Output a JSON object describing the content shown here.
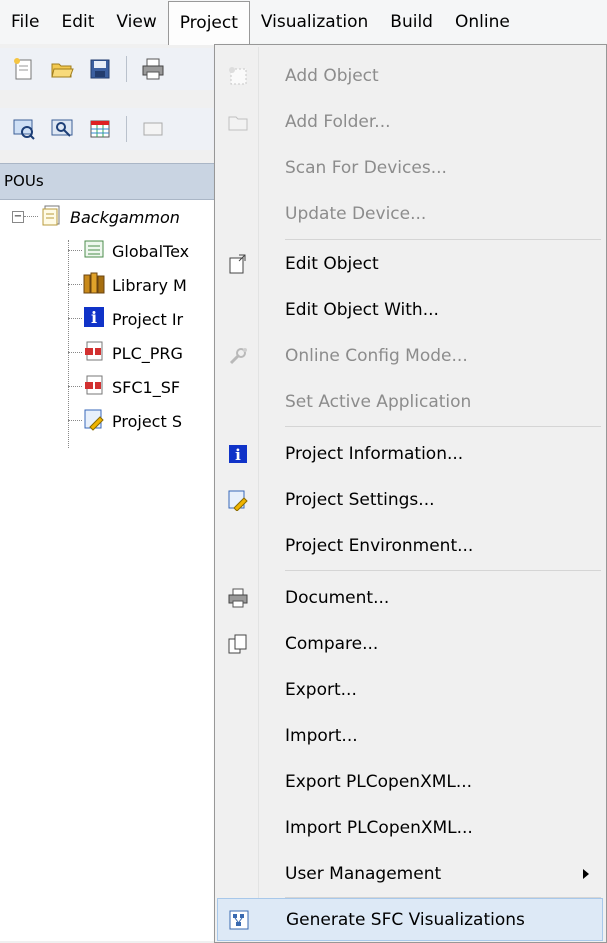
{
  "menubar": {
    "items": [
      {
        "label": "File"
      },
      {
        "label": "Edit"
      },
      {
        "label": "View"
      },
      {
        "label": "Project"
      },
      {
        "label": "Visualization"
      },
      {
        "label": "Build"
      },
      {
        "label": "Online"
      }
    ],
    "active": "Project"
  },
  "pous": {
    "title": "POUs",
    "tree": [
      {
        "label": "Backgammon",
        "icon": "project-file-icon",
        "italic": true
      },
      {
        "label": "GlobalTex",
        "icon": "text-list-icon"
      },
      {
        "label": "Library M",
        "icon": "library-icon"
      },
      {
        "label": "Project Ir",
        "icon": "info-icon"
      },
      {
        "label": "PLC_PRG",
        "icon": "pou-icon"
      },
      {
        "label": "SFC1_SF",
        "icon": "pou-icon"
      },
      {
        "label": "Project S",
        "icon": "settings-icon"
      }
    ]
  },
  "project_menu": {
    "items": [
      {
        "label": "Add Object",
        "enabled": false
      },
      {
        "label": "Add Folder...",
        "enabled": false
      },
      {
        "label": "Scan For Devices...",
        "enabled": false
      },
      {
        "label": "Update Device...",
        "enabled": false
      },
      {
        "label": "Edit Object",
        "enabled": true
      },
      {
        "label": "Edit Object With...",
        "enabled": true
      },
      {
        "label": "Online Config Mode...",
        "enabled": false
      },
      {
        "label": "Set Active Application",
        "enabled": false
      },
      {
        "label": "Project Information...",
        "enabled": true
      },
      {
        "label": "Project Settings...",
        "enabled": true
      },
      {
        "label": "Project Environment...",
        "enabled": true
      },
      {
        "label": "Document...",
        "enabled": true
      },
      {
        "label": "Compare...",
        "enabled": true
      },
      {
        "label": "Export...",
        "enabled": true
      },
      {
        "label": "Import...",
        "enabled": true
      },
      {
        "label": "Export PLCopenXML...",
        "enabled": true
      },
      {
        "label": "Import PLCopenXML...",
        "enabled": true
      },
      {
        "label": "User Management",
        "enabled": true,
        "submenu": true
      },
      {
        "label": "Generate SFC Visualizations",
        "enabled": true,
        "highlighted": true
      }
    ]
  }
}
